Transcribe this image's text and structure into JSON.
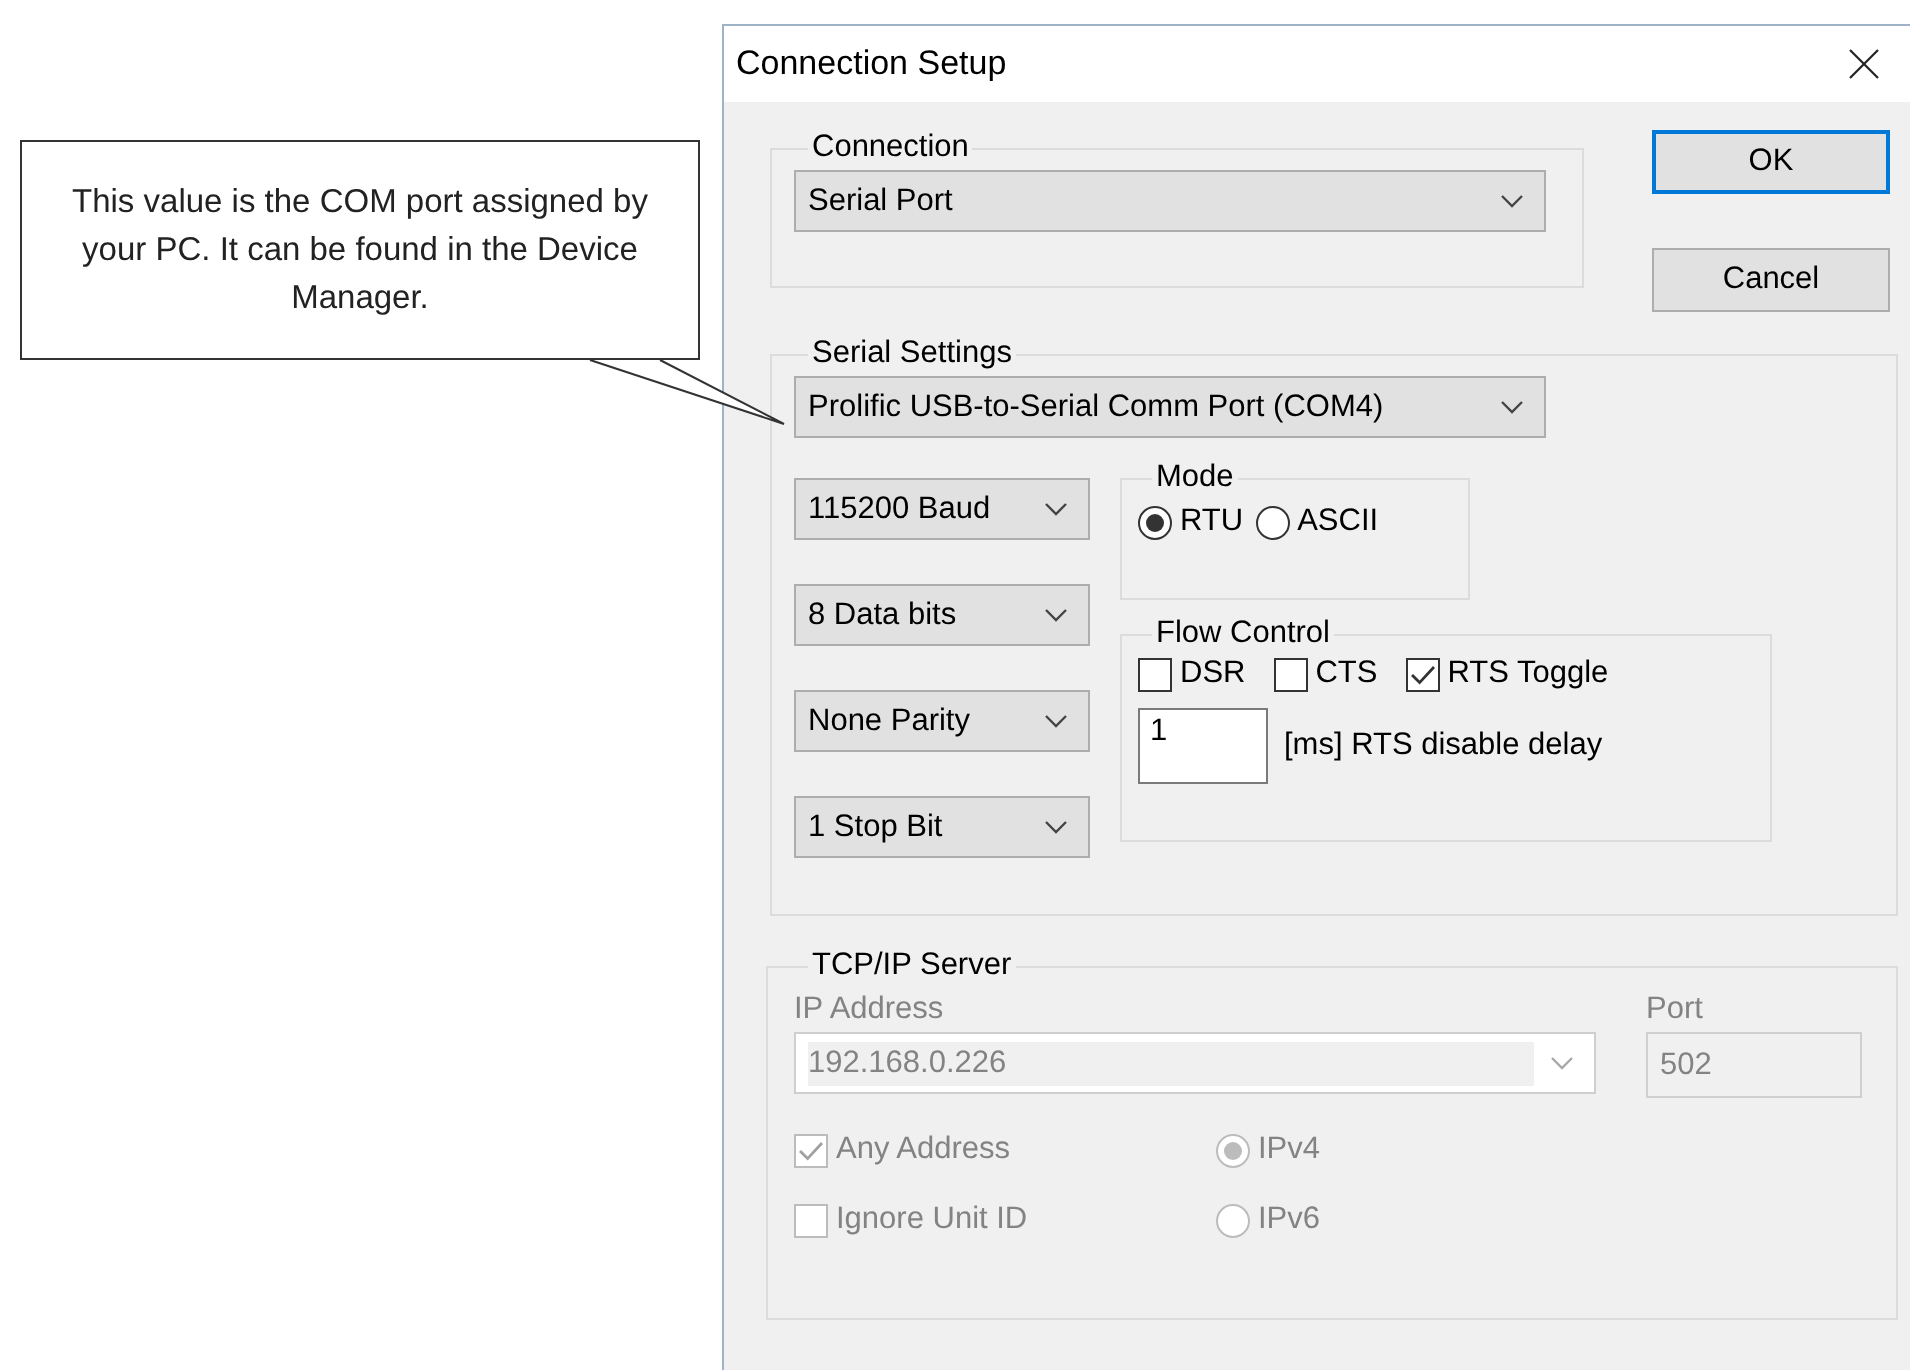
{
  "callout": {
    "text": "This value is the COM port assigned by your PC. It can be found in the Device Manager."
  },
  "window": {
    "title": "Connection Setup"
  },
  "connection": {
    "label": "Connection",
    "value": "Serial Port"
  },
  "buttons": [
    {
      "label": "OK",
      "default": true
    },
    {
      "label": "Cancel",
      "default": false
    }
  ],
  "serial_settings": {
    "label": "Serial Settings",
    "port": "Prolific USB-to-Serial Comm Port (COM4)",
    "dropdowns": [
      "115200 Baud",
      "8 Data bits",
      "None Parity",
      "1 Stop Bit"
    ],
    "mode": {
      "label": "Mode",
      "options": [
        {
          "label": "RTU",
          "selected": true
        },
        {
          "label": "ASCII",
          "selected": false
        }
      ]
    },
    "flow_control": {
      "label": "Flow Control",
      "options": [
        {
          "label": "DSR",
          "checked": false
        },
        {
          "label": "CTS",
          "checked": false
        },
        {
          "label": "RTS Toggle",
          "checked": true
        }
      ],
      "delay": {
        "value": "1",
        "label": "[ms] RTS disable delay"
      }
    }
  },
  "tcp_server": {
    "label": "TCP/IP Server",
    "disabled": true,
    "ip_address_label": "IP Address",
    "ip_address": "192.168.0.226",
    "port_label": "Port",
    "port": "502",
    "checks": [
      {
        "label": "Any Address",
        "checked": true
      },
      {
        "label": "Ignore Unit ID",
        "checked": false
      }
    ],
    "ip_versions": [
      {
        "label": "IPv4",
        "selected": true
      },
      {
        "label": "IPv6",
        "selected": false
      }
    ]
  }
}
